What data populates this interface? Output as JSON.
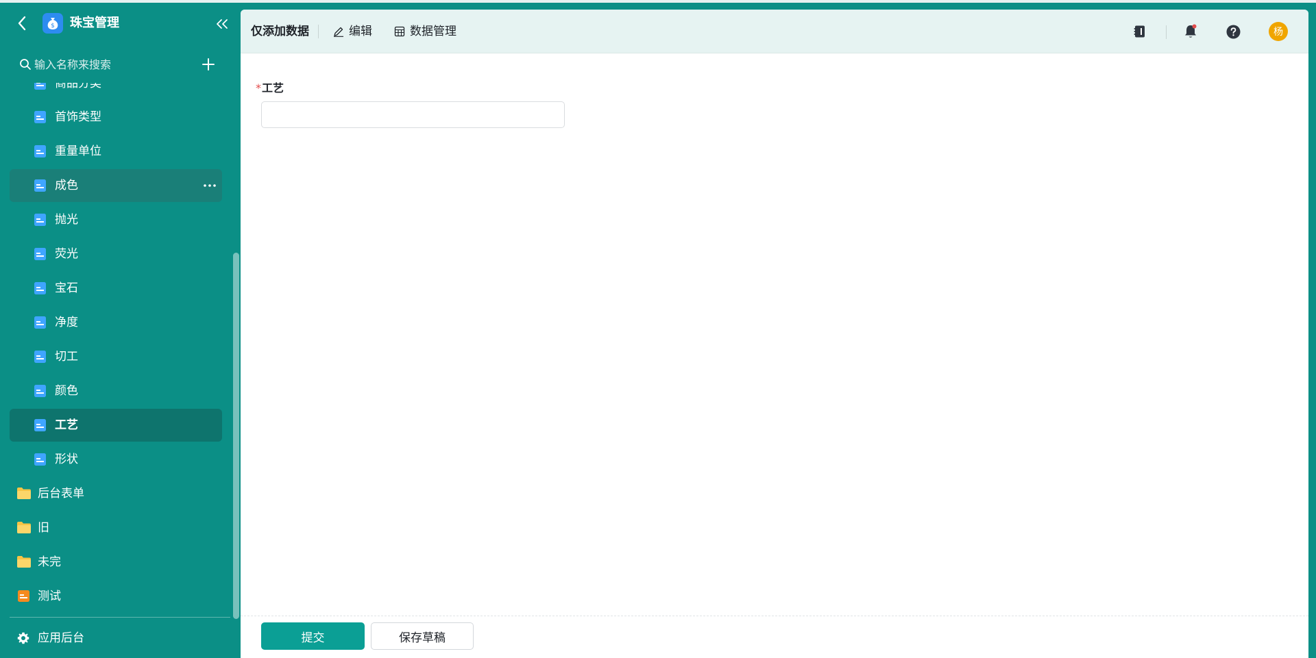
{
  "app": {
    "title": "珠宝管理",
    "icon": "money-bag-icon",
    "accent_color": "#0b8f86"
  },
  "sidebar": {
    "search": {
      "placeholder": "输入名称来搜索"
    },
    "items": [
      {
        "label": "商品分类",
        "type": "form",
        "state": "normal"
      },
      {
        "label": "首饰类型",
        "type": "form",
        "state": "normal"
      },
      {
        "label": "重量单位",
        "type": "form",
        "state": "normal"
      },
      {
        "label": "成色",
        "type": "form",
        "state": "hover"
      },
      {
        "label": "抛光",
        "type": "form",
        "state": "normal"
      },
      {
        "label": "荧光",
        "type": "form",
        "state": "normal"
      },
      {
        "label": "宝石",
        "type": "form",
        "state": "normal"
      },
      {
        "label": "净度",
        "type": "form",
        "state": "normal"
      },
      {
        "label": "切工",
        "type": "form",
        "state": "normal"
      },
      {
        "label": "颜色",
        "type": "form",
        "state": "normal"
      },
      {
        "label": "工艺",
        "type": "form",
        "state": "active"
      },
      {
        "label": "形状",
        "type": "form",
        "state": "normal"
      },
      {
        "label": "后台表单",
        "type": "folder",
        "state": "normal"
      },
      {
        "label": "旧",
        "type": "folder",
        "state": "normal"
      },
      {
        "label": "未完",
        "type": "folder",
        "state": "normal"
      },
      {
        "label": "测试",
        "type": "orange-form",
        "state": "normal"
      }
    ],
    "backend_label": "应用后台"
  },
  "toolbar": {
    "title": "仅添加数据",
    "edit_label": "编辑",
    "data_label": "数据管理",
    "icons": [
      "notebook-icon",
      "bell-icon",
      "help-icon"
    ],
    "avatar_text": "杨",
    "avatar_color": "#f0a500"
  },
  "form": {
    "field_label": "工艺",
    "required_mark": "*",
    "field_value": ""
  },
  "footer": {
    "submit_label": "提交",
    "draft_label": "保存草稿"
  }
}
